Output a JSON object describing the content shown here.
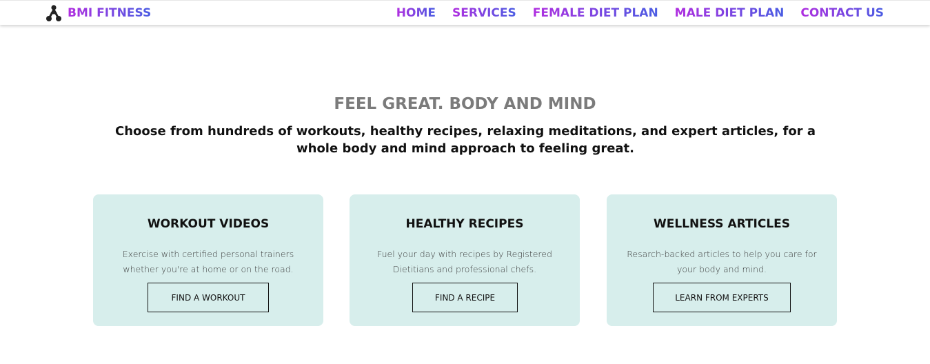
{
  "nav": {
    "brand": "BMI FITNESS",
    "brand_icon": "barbell-figure-icon",
    "links": [
      "HOME",
      "SERVICES",
      "FEMALE DIET PLAN",
      "MALE DIET PLAN",
      "CONTACT US"
    ]
  },
  "hero": {
    "title": "FEEL GREAT. BODY AND MIND",
    "subtitle": "Choose from hundreds of workouts, healthy recipes, relaxing meditations, and expert articles, for a whole body and mind approach to feeling great."
  },
  "cards": [
    {
      "title": "WORKOUT VIDEOS",
      "text": "Exercise with certified personal trainers whether you're at home or on the road.",
      "button": "FIND A WORKOUT"
    },
    {
      "title": "HEALTHY RECIPES",
      "text": "Fuel your day with recipes by Registered Dietitians and professional chefs.",
      "button": "FIND A RECIPE"
    },
    {
      "title": "WELLNESS ARTICLES",
      "text": "Resarch-backed articles to help you care for your body and mind.",
      "button": "LEARN FROM EXPERTS"
    }
  ],
  "colors": {
    "gradient_start": "#b02ee0",
    "gradient_end": "#4a5de3",
    "card_background": "#d7eeec",
    "hero_title": "#7b7b7b"
  }
}
